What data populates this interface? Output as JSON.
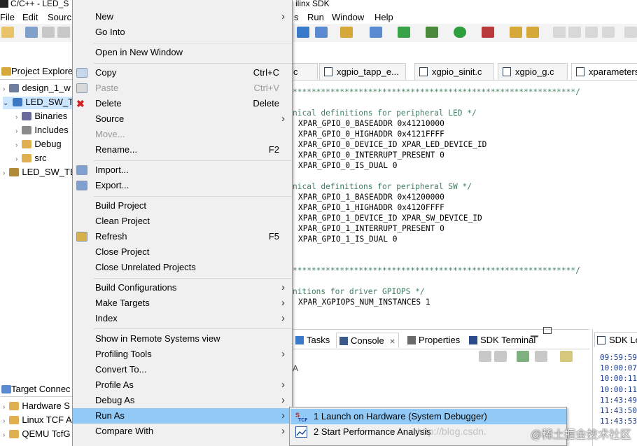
{
  "window": {
    "title_left": "C/C++ - LED_S",
    "title_right": "ilinx SDK"
  },
  "menubar": {
    "file": "File",
    "edit": "Edit",
    "source": "Sourc",
    "run": "Run",
    "window": "Window",
    "help": "Help",
    "partial": "s"
  },
  "project_explorer": {
    "tab_label": "Project Explore",
    "items": [
      {
        "label": "design_1_w"
      },
      {
        "label": "LED_SW_TE"
      },
      {
        "label": "Binaries"
      },
      {
        "label": "Includes"
      },
      {
        "label": "Debug"
      },
      {
        "label": "src"
      },
      {
        "label": "LED_SW_TE"
      }
    ]
  },
  "editor": {
    "tabs": [
      {
        "label": "c"
      },
      {
        "label": "xgpio_tapp_e..."
      },
      {
        "label": "xgpio_sinit.c"
      },
      {
        "label": "xgpio_g.c"
      },
      {
        "label": "xparameters"
      }
    ],
    "lines": [
      {
        "text": "************************************************************/",
        "style": "cmt"
      },
      {
        "text": "",
        "style": "blk"
      },
      {
        "text": "nical definitions for peripheral LED */",
        "style": "cmt"
      },
      {
        "text": "XPAR_GPIO_0_BASEADDR 0x41210000",
        "style": "blk"
      },
      {
        "text": "XPAR_GPIO_0_HIGHADDR 0x4121FFFF",
        "style": "blk"
      },
      {
        "text": "XPAR_GPIO_0_DEVICE_ID XPAR_LED_DEVICE_ID",
        "style": "blk"
      },
      {
        "text": "XPAR_GPIO_0_INTERRUPT_PRESENT 0",
        "style": "blk"
      },
      {
        "text": "XPAR_GPIO_0_IS_DUAL 0",
        "style": "blk"
      },
      {
        "text": "",
        "style": "blk"
      },
      {
        "text": "nical definitions for peripheral SW */",
        "style": "cmt"
      },
      {
        "text": "XPAR_GPIO_1_BASEADDR 0x41200000",
        "style": "blk"
      },
      {
        "text": "XPAR_GPIO_1_HIGHADDR 0x4120FFFF",
        "style": "blk"
      },
      {
        "text": "XPAR_GPIO_1_DEVICE_ID XPAR_SW_DEVICE_ID",
        "style": "blk"
      },
      {
        "text": "XPAR_GPIO_1_INTERRUPT_PRESENT 0",
        "style": "blk"
      },
      {
        "text": "XPAR_GPIO_1_IS_DUAL 0",
        "style": "blk"
      },
      {
        "text": "",
        "style": "blk"
      },
      {
        "text": "",
        "style": "blk"
      },
      {
        "text": "************************************************************/",
        "style": "cmt"
      },
      {
        "text": "",
        "style": "blk"
      },
      {
        "text": "nitions for driver GPIOPS */",
        "style": "cmt"
      },
      {
        "text": "XPAR_XGPIOPS_NUM_INSTANCES 1",
        "style": "blk"
      }
    ]
  },
  "lower_tabs": {
    "tasks": "Tasks",
    "console": "Console",
    "console_close": "✕",
    "properties": "Properties",
    "sdk_terminal": "SDK Terminal",
    "partial_a": "A"
  },
  "sdk_log": {
    "tab_label": "SDK Lo",
    "lines": [
      "09:59:59",
      "10:00:07",
      "10:00:11",
      "10:00:11",
      "11:43:49",
      "11:43:50",
      "11:43:53"
    ]
  },
  "target_connections": {
    "tab_label": "Target Connec",
    "items": [
      {
        "label": "Hardware S"
      },
      {
        "label": "Linux TCF A"
      },
      {
        "label": "QEMU TcfG"
      }
    ]
  },
  "context_menu": {
    "items": [
      {
        "label": "New",
        "accel": "",
        "submenu": true,
        "disabled": false
      },
      {
        "label": "Go Into",
        "accel": "",
        "submenu": false,
        "disabled": false
      },
      {
        "label": "Open in New Window",
        "accel": "",
        "submenu": false,
        "disabled": false
      },
      {
        "label": "Copy",
        "accel": "Ctrl+C",
        "submenu": false,
        "disabled": false
      },
      {
        "label": "Paste",
        "accel": "Ctrl+V",
        "submenu": false,
        "disabled": true
      },
      {
        "label": "Delete",
        "accel": "Delete",
        "submenu": false,
        "disabled": false
      },
      {
        "label": "Source",
        "accel": "",
        "submenu": true,
        "disabled": false
      },
      {
        "label": "Move...",
        "accel": "",
        "submenu": false,
        "disabled": true
      },
      {
        "label": "Rename...",
        "accel": "F2",
        "submenu": false,
        "disabled": false
      },
      {
        "label": "Import...",
        "accel": "",
        "submenu": false,
        "disabled": false
      },
      {
        "label": "Export...",
        "accel": "",
        "submenu": false,
        "disabled": false
      },
      {
        "label": "Build Project",
        "accel": "",
        "submenu": false,
        "disabled": false
      },
      {
        "label": "Clean Project",
        "accel": "",
        "submenu": false,
        "disabled": false
      },
      {
        "label": "Refresh",
        "accel": "F5",
        "submenu": false,
        "disabled": false
      },
      {
        "label": "Close Project",
        "accel": "",
        "submenu": false,
        "disabled": false
      },
      {
        "label": "Close Unrelated Projects",
        "accel": "",
        "submenu": false,
        "disabled": false
      },
      {
        "label": "Build Configurations",
        "accel": "",
        "submenu": true,
        "disabled": false
      },
      {
        "label": "Make Targets",
        "accel": "",
        "submenu": true,
        "disabled": false
      },
      {
        "label": "Index",
        "accel": "",
        "submenu": true,
        "disabled": false
      },
      {
        "label": "Show in Remote Systems view",
        "accel": "",
        "submenu": false,
        "disabled": false
      },
      {
        "label": "Profiling Tools",
        "accel": "",
        "submenu": true,
        "disabled": false
      },
      {
        "label": "Convert To...",
        "accel": "",
        "submenu": false,
        "disabled": false
      },
      {
        "label": "Profile As",
        "accel": "",
        "submenu": true,
        "disabled": false
      },
      {
        "label": "Debug As",
        "accel": "",
        "submenu": true,
        "disabled": false
      },
      {
        "label": "Run As",
        "accel": "",
        "submenu": true,
        "disabled": false,
        "selected": true
      },
      {
        "label": "Compare With",
        "accel": "",
        "submenu": true,
        "disabled": false
      }
    ]
  },
  "run_as_submenu": {
    "items": [
      {
        "label": "1 Launch on Hardware (System Debugger)",
        "selected": true
      },
      {
        "label": "2 Start Performance Analysis",
        "selected": false
      }
    ]
  },
  "watermark": "@稀土掘金技术社区",
  "blog_mark": "http://blog.csdn.",
  "colors": {
    "menu_bg": "#f0f0f0",
    "menu_highlight": "#91c9f7",
    "comment_green": "#3f7f5f",
    "log_blue": "#1c3a8a"
  }
}
